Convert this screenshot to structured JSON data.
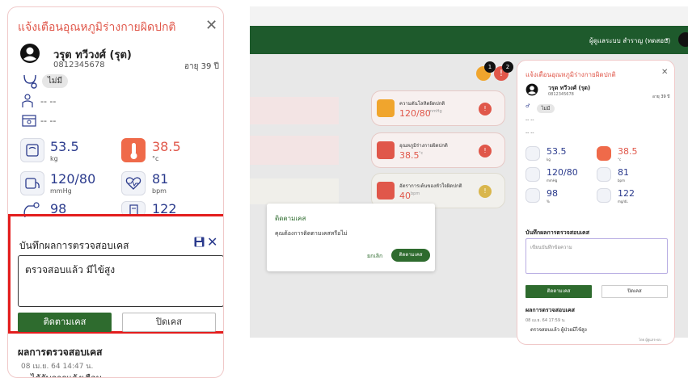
{
  "left_panel": {
    "title": "แจ้งเตือนอุณหภูมิร่างกายผิดปกติ",
    "patient_name": "วรุต ทวีวงศ์ (รุต)",
    "phone": "0812345678",
    "age": "อายุ 39 ปี",
    "allergy_pill": "ไม่มี",
    "dash_1": "-- --",
    "dash_2": "-- --",
    "vitals": {
      "weight": {
        "value": "53.5",
        "unit": "kg"
      },
      "temperature": {
        "value": "38.5",
        "unit": "°c"
      },
      "blood_pressure": {
        "value": "120/80",
        "unit": "mmHg"
      },
      "heart_rate": {
        "value": "81",
        "unit": "bpm"
      },
      "oxygen": {
        "value": "98",
        "unit": ""
      },
      "glucose": {
        "value": "122",
        "unit": ""
      }
    },
    "record_title": "บันทึกผลการตรวจสอบเคส",
    "note_value": "ตรวจสอบแล้ว มีไข้สูง",
    "follow_button": "ติดตามเคส",
    "close_case_button": "ปิดเคส",
    "results_title": "ผลการตรวจสอบเคส",
    "result_date": "08 เม.ย. 64 14:47 น.",
    "result_text": "ได้รับการแจ้งเตือน"
  },
  "app": {
    "user_menu": "ผู้ดูแลระบบ สำราญ (ทดสอบ)",
    "badges": [
      "1",
      "2"
    ],
    "cards": [
      {
        "label": "ความดันโลหิตผิดปกติ",
        "value": "120/80",
        "unit": "mmHg",
        "dot": "!"
      },
      {
        "label": "อุณหภูมิร่างกายผิดปกติ",
        "value": "38.5",
        "unit": "°c",
        "dot": "!"
      },
      {
        "label": "อัตราการเต้นของหัวใจผิดปกติ",
        "value": "40",
        "unit": "bpm",
        "dot": "!"
      }
    ],
    "colors": {
      "topbar": "#1e5a2c",
      "accent_red": "#e0574a",
      "primary_green": "#2e6b2e"
    }
  },
  "dialog": {
    "title": "ติดตามเคส",
    "message": "คุณต้องการติดตามเคสหรือไม่",
    "cancel": "ยกเลิก",
    "confirm": "ติดตามเคส"
  },
  "mini_panel": {
    "title": "แจ้งเตือนอุณหภูมิร่างกายผิดปกติ",
    "patient_name": "วรุต ทวีวงศ์ (รุต)",
    "phone": "0812345678",
    "age": "อายุ 39 ปี",
    "allergy_pill": "ไม่มี",
    "dash_1": "-- --",
    "dash_2": "-- --",
    "vitals": {
      "weight": {
        "value": "53.5",
        "unit": "kg"
      },
      "temperature": {
        "value": "38.5",
        "unit": "°c"
      },
      "blood_pressure": {
        "value": "120/80",
        "unit": "mmHg"
      },
      "heart_rate": {
        "value": "81",
        "unit": "bpm"
      },
      "oxygen": {
        "value": "98",
        "unit": "%"
      },
      "glucose": {
        "value": "122",
        "unit": "mg/dL"
      }
    },
    "record_title": "บันทึกผลการตรวจสอบเคส",
    "note_placeholder": "เขียนบันทึกข้อความ",
    "follow_button": "ติดตามเคส",
    "close_case_button": "ปิดเคส",
    "results_title": "ผลการตรวจสอบเคส",
    "result_date": "08 เม.ย. 64 17:59 น.",
    "result_text": "ตรวจสอบแล้ว ผู้ป่วยมีไข้สูง",
    "result_by": "โดย ผู้ดูแลระบบ"
  }
}
